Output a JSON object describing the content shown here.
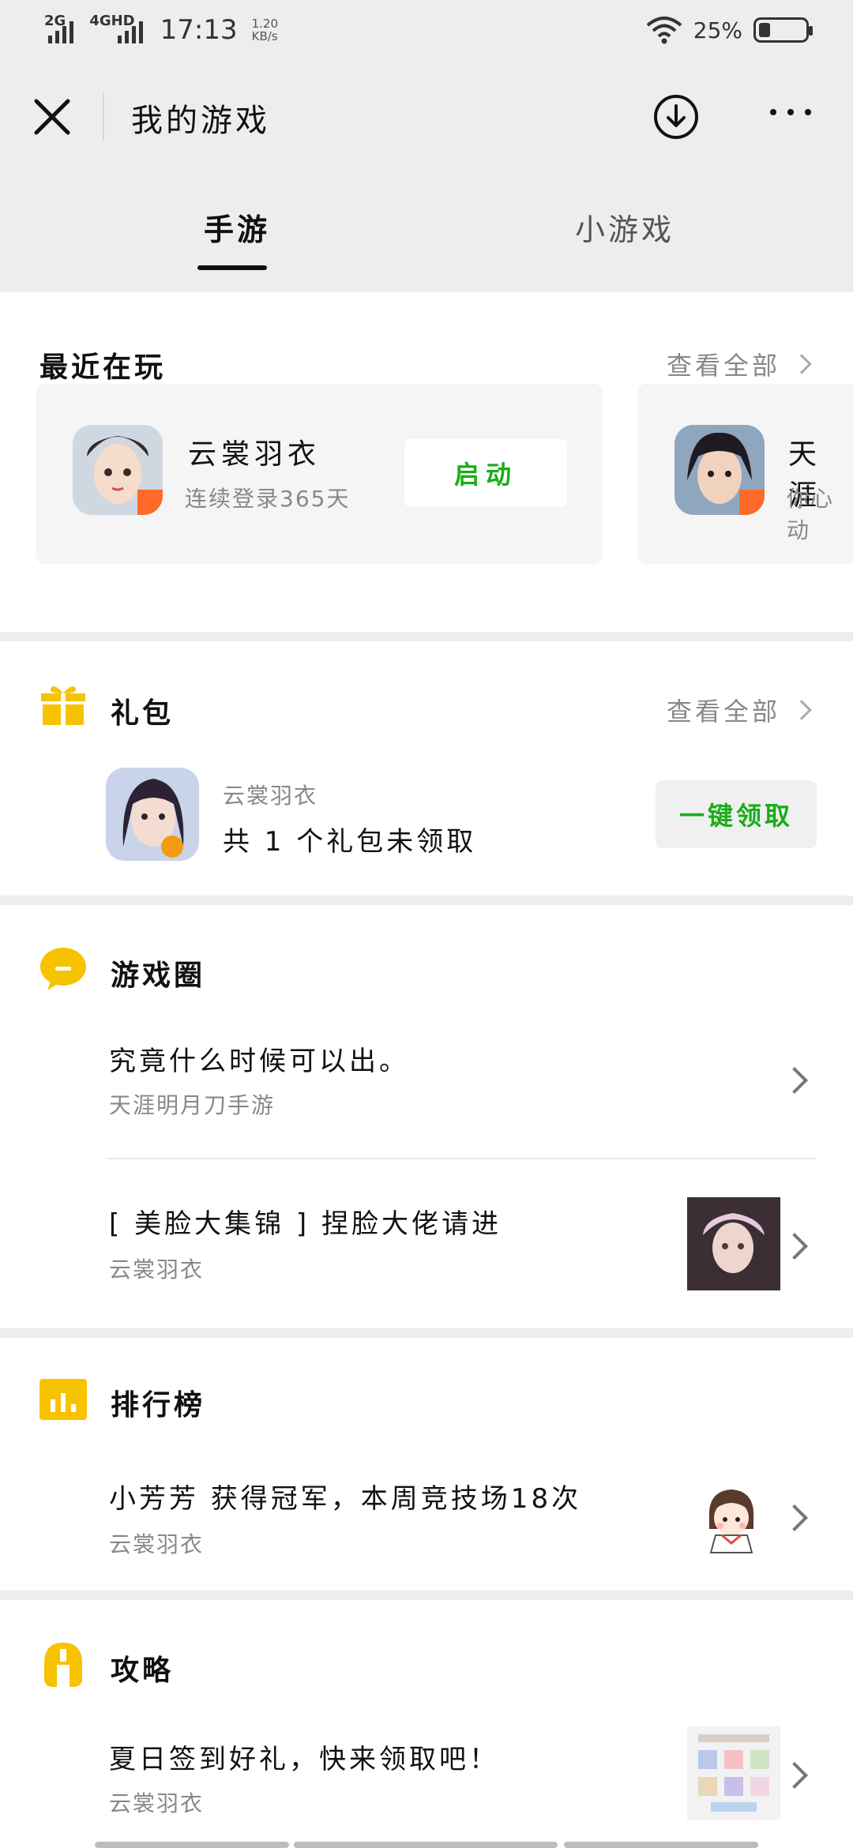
{
  "status_bar": {
    "network_1": "2G",
    "network_2": "4GHD",
    "time": "17:13",
    "speed_value": "1.20",
    "speed_unit": "KB/s",
    "battery_percent": "25%",
    "battery_level": 0.25
  },
  "nav": {
    "title": "我的游戏"
  },
  "tabs": [
    {
      "label": "手游",
      "active": true
    },
    {
      "label": "小游戏",
      "active": false
    }
  ],
  "recent": {
    "title": "最近在玩",
    "see_all": "查看全部",
    "games": [
      {
        "name": "云裳羽衣",
        "sub": "连续登录365天",
        "button": "启动"
      },
      {
        "name": "天涯",
        "sub": "你心动"
      }
    ]
  },
  "gift": {
    "title": "礼包",
    "see_all": "查看全部",
    "game_name": "云裳羽衣",
    "desc": "共 1 个礼包未领取",
    "button": "一键领取"
  },
  "circle": {
    "title": "游戏圈",
    "posts": [
      {
        "title": "究竟什么时候可以出。",
        "sub": "天涯明月刀手游"
      },
      {
        "title": "[ 美脸大集锦 ] 捏脸大佬请进",
        "sub": "云裳羽衣"
      }
    ]
  },
  "ranking": {
    "title": "排行榜",
    "item": {
      "title": "小芳芳 获得冠军，本周竞技场18次",
      "sub": "云裳羽衣"
    }
  },
  "guide": {
    "title": "攻略",
    "item": {
      "title": "夏日签到好礼，快来领取吧！",
      "sub": "云裳羽衣"
    }
  },
  "colors": {
    "accent_green": "#1aad19",
    "icon_yellow": "#f7c200"
  }
}
